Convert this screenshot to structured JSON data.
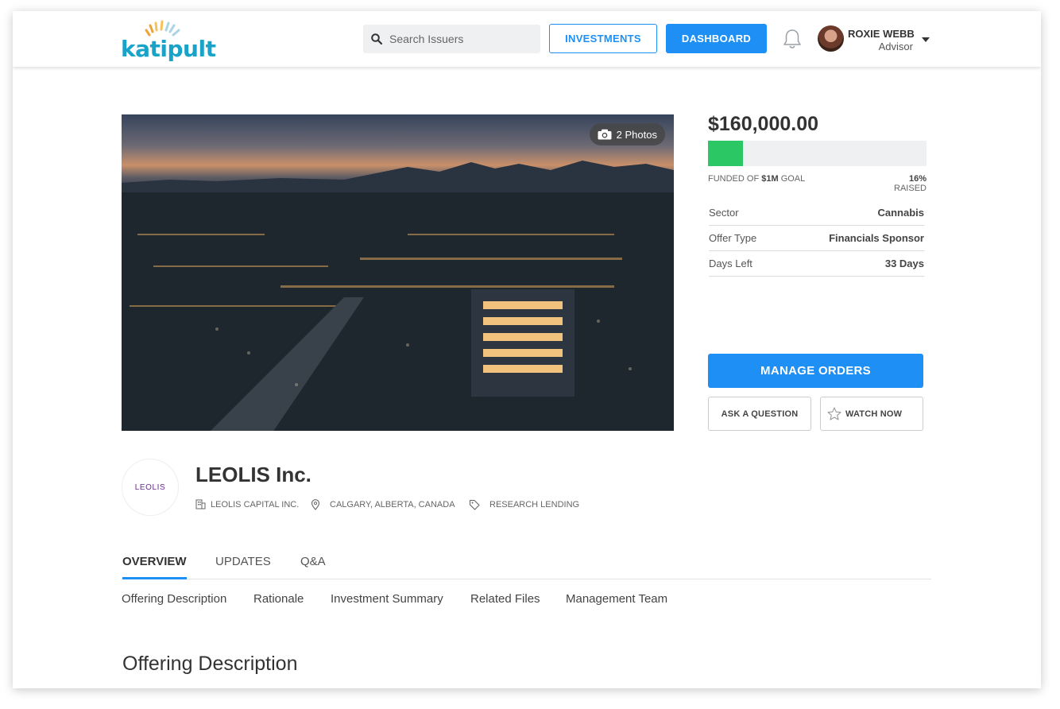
{
  "header": {
    "logo_text_a": "ka",
    "logo_text_b": "tipult",
    "search_placeholder": "Search Issuers",
    "investments_label": "INVESTMENTS",
    "dashboard_label": "DASHBOARD",
    "user": {
      "name": "ROXIE WEBB",
      "role": "Advisor"
    }
  },
  "hero": {
    "photos_label": "2 Photos"
  },
  "funding": {
    "amount": "$160,000.00",
    "progress_fraction": 0.16,
    "funded_prefix": "FUNDED OF ",
    "funded_goal": "$1M",
    "funded_suffix": " GOAL",
    "raised_pct": "16%",
    "raised_suffix": " RAISED",
    "details": [
      {
        "key": "Sector",
        "value": "Cannabis"
      },
      {
        "key": "Offer Type",
        "value": "Financials Sponsor"
      },
      {
        "key": "Days Left",
        "value": "33 Days"
      }
    ],
    "manage_label": "MANAGE ORDERS",
    "ask_label": "ASK A QUESTION",
    "watch_label": "WATCH NOW"
  },
  "company": {
    "logo_text": "LEOLIS",
    "name": "LEOLIS Inc.",
    "parent": "LEOLIS CAPITAL INC.",
    "location": "CALGARY, ALBERTA, CANADA",
    "tag": "RESEARCH LENDING"
  },
  "tabs": [
    "OVERVIEW",
    "UPDATES",
    "Q&A"
  ],
  "subnav": [
    "Offering Description",
    "Rationale",
    "Investment Summary",
    "Related Files",
    "Management Team"
  ],
  "section_title": "Offering Description",
  "colors": {
    "accent": "#1e8ff5",
    "progress": "#2ac764"
  }
}
